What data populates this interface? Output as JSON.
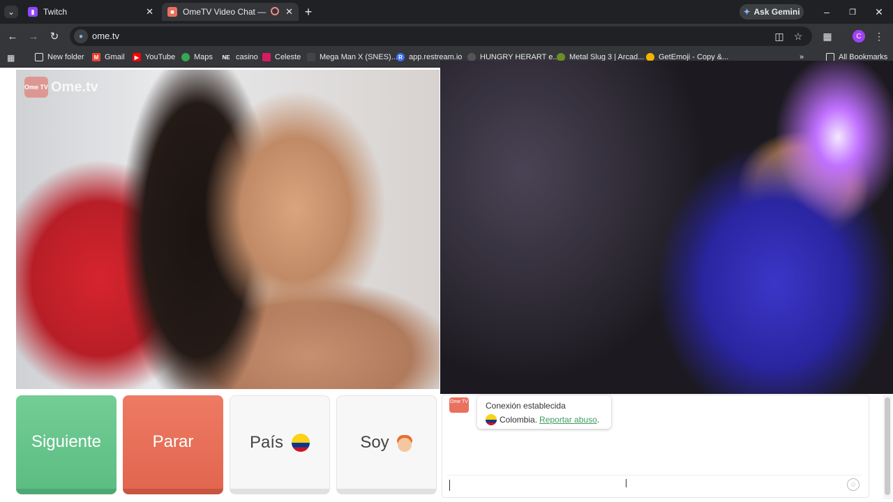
{
  "browser": {
    "tabs": [
      {
        "title": "Twitch",
        "favicon_color": "#9146ff",
        "active": false
      },
      {
        "title": "OmeTV Video Chat — Ome",
        "favicon_color": "#e9715f",
        "active": true
      }
    ],
    "ask_gemini": "Ask Gemini",
    "url": "ome.tv",
    "profile_initial": "C",
    "bookmarks": [
      {
        "label": "New folder",
        "icon": "folder-icon"
      },
      {
        "label": "Gmail",
        "icon": "gmail-icon"
      },
      {
        "label": "YouTube",
        "icon": "youtube-icon"
      },
      {
        "label": "Maps",
        "icon": "maps-icon"
      },
      {
        "label": "casino",
        "icon": "ne-icon",
        "icon_text": "NE"
      },
      {
        "label": "Celeste",
        "icon": "celeste-icon"
      },
      {
        "label": "Mega Man X (SNES)...",
        "icon": "megaman-icon"
      },
      {
        "label": "app.restream.io",
        "icon": "restream-icon",
        "icon_text": "R"
      },
      {
        "label": "HUNGRY HERART e...",
        "icon": "hungry-icon"
      },
      {
        "label": "Metal Slug 3 | Arcad...",
        "icon": "metalslug-icon"
      },
      {
        "label": "GetEmoji - Copy &...",
        "icon": "emoji-icon"
      }
    ],
    "all_bookmarks": "All Bookmarks"
  },
  "page": {
    "logo_text": "Ome.tv",
    "logo_badge": "Ome TV",
    "buttons": {
      "next": "Siguiente",
      "stop": "Parar",
      "country": "País",
      "gender": "Soy"
    },
    "chat": {
      "logo_badge": "Ome TV",
      "connection": "Conexión establecida",
      "country": "Colombia.",
      "report": "Reportar abuso",
      "report_suffix": "."
    }
  },
  "colors": {
    "next_button": "#5cbd82",
    "stop_button": "#e2664f",
    "link": "#3e9b61"
  }
}
